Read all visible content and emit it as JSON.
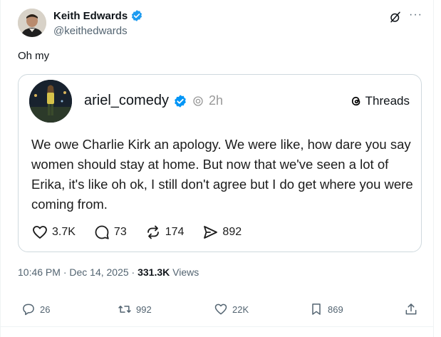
{
  "author": {
    "name": "Keith Edwards",
    "handle": "@keithedwards"
  },
  "tweet": {
    "text": "Oh my",
    "timestamp": "10:46 PM · Dec 14, 2025 · ",
    "views_count": "331.3K",
    "views_label": " Views"
  },
  "embed": {
    "username": "ariel_comedy",
    "time": "2h",
    "brand": "Threads",
    "body": "We owe Charlie Kirk an apology. We were like, how dare you say women should stay at home. But now that we've seen a lot of Erika, it's like oh ok, I still don't agree but I do get where you were coming from.",
    "stats": {
      "likes": "3.7K",
      "replies": "73",
      "reposts": "174",
      "shares": "892"
    }
  },
  "actions": {
    "replies": "26",
    "reposts": "992",
    "likes": "22K",
    "bookmarks": "869"
  },
  "colors": {
    "verified": "#1d9bf0",
    "secondary_text": "#536471",
    "border": "#cfd9de"
  },
  "icons": [
    "verified-badge-icon",
    "grok-icon",
    "more-icon",
    "threads-logo-icon",
    "heart-icon",
    "comment-icon",
    "repost-icon",
    "share-icon",
    "reply-icon",
    "bookmark-icon",
    "upload-icon"
  ]
}
